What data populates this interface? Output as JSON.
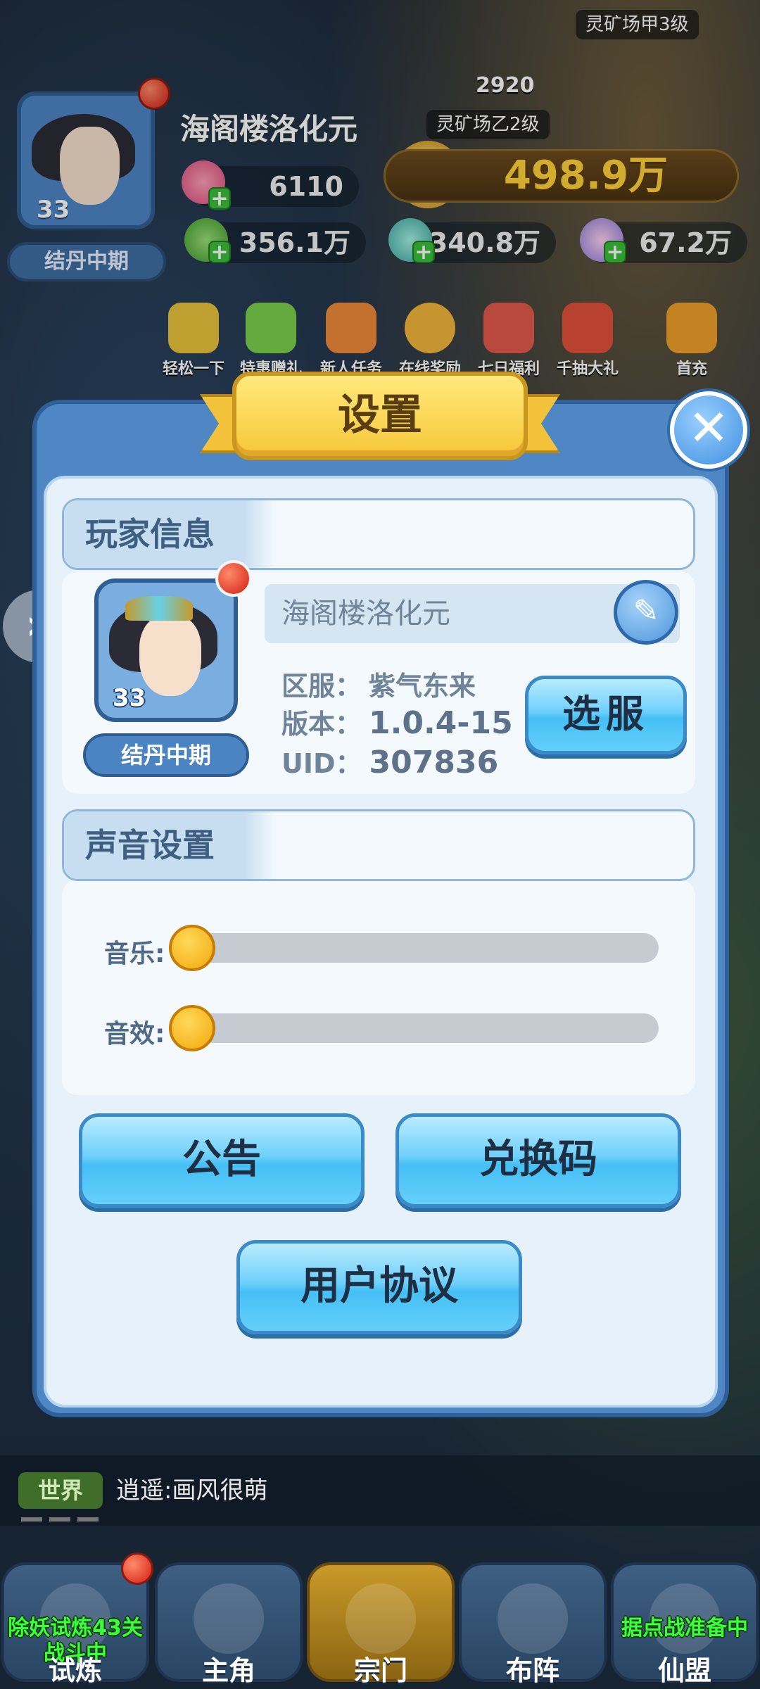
{
  "hud": {
    "player_name": "海阁楼洛化元",
    "level": "33",
    "realm": "结丹中期",
    "peach": "6110",
    "power": "498.9万",
    "res1": "356.1万",
    "res2": "340.8万",
    "res3": "67.2万",
    "mine_a": "灵矿场甲3级",
    "mine_b": "灵矿场乙2级",
    "mine_num": "2920"
  },
  "features": [
    "轻松一下",
    "特惠赠礼",
    "新人任务",
    "在线奖励",
    "七日福利",
    "千抽大礼",
    "首充"
  ],
  "modal": {
    "title": "设置",
    "close": "✕",
    "player_section": "玩家信息",
    "avatar_level": "33",
    "realm": "结丹中期",
    "name": "海阁楼洛化元",
    "server_label": "区服：",
    "server_value": "紫气东来",
    "version_label": "版本：",
    "version_value": "1.0.4-15",
    "uid_label": "UID：",
    "uid_value": "307836",
    "select_server": "选服",
    "sound_section": "声音设置",
    "music_label": "音乐:",
    "effect_label": "音效:",
    "music_level": 0,
    "effect_level": 0,
    "notice_button": "公告",
    "redeem_button": "兑换码",
    "agreement_button": "用户协议"
  },
  "chat": {
    "channel": "世界",
    "message": "逍遥:画风很萌"
  },
  "nav": [
    {
      "label": "试炼",
      "caption": "除妖试炼43关战斗中"
    },
    {
      "label": "主角",
      "caption": ""
    },
    {
      "label": "宗门",
      "caption": ""
    },
    {
      "label": "布阵",
      "caption": ""
    },
    {
      "label": "仙盟",
      "caption": "据点战准备中"
    }
  ]
}
